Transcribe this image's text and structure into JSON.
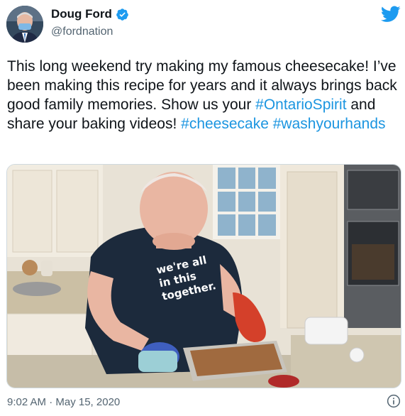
{
  "author": {
    "name": "Doug Ford",
    "handle": "@fordnation",
    "verified": true,
    "avatar_icon": "profile-photo"
  },
  "tweet": {
    "text_segments": [
      {
        "text": "This long weekend try making my famous cheesecake! I’ve been making this recipe for years and it always brings back good family memories. Show us your ",
        "type": "text"
      },
      {
        "text": "#OntarioSpirit",
        "type": "hashtag"
      },
      {
        "text": " and share your baking videos! ",
        "type": "text"
      },
      {
        "text": "#cheesecake",
        "type": "hashtag"
      },
      {
        "text": " ",
        "type": "text"
      },
      {
        "text": "#washyourhands",
        "type": "hashtag"
      }
    ],
    "shirt_text": [
      "we're all",
      "in this",
      "together."
    ]
  },
  "footer": {
    "timestamp": "9:02 AM · May 15, 2020"
  },
  "colors": {
    "hashtag": "#1b95e0",
    "verified": "#1d9bf0",
    "twitter_bird": "#1d9bf0",
    "secondary_text": "#536471"
  },
  "icons": {
    "logo": "twitter-bird-icon",
    "verified": "verified-badge-icon",
    "info": "info-icon"
  }
}
